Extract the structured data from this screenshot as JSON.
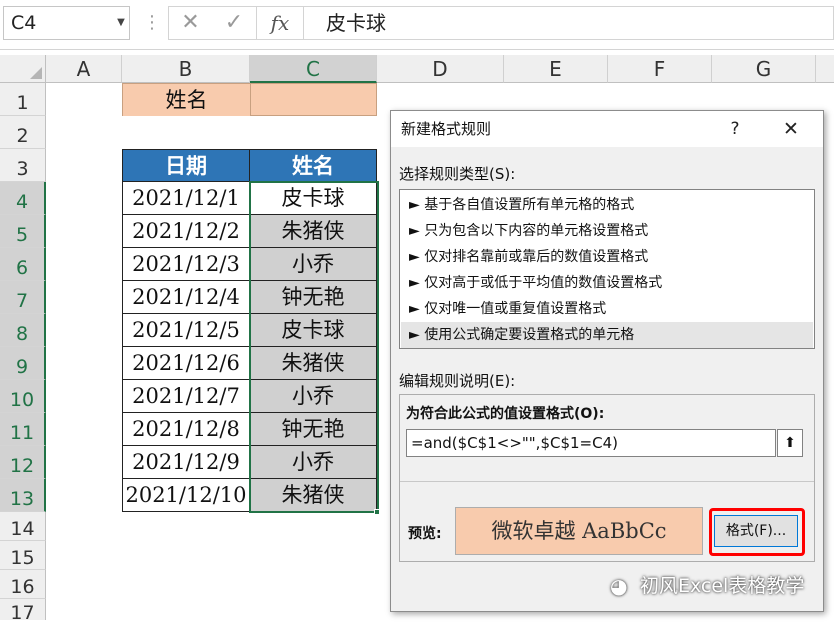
{
  "formula_bar": {
    "name_box": "C4",
    "cancel_icon": "✕",
    "enter_icon": "✓",
    "fx_label": "fx",
    "formula": "皮卡球"
  },
  "columns": [
    "A",
    "B",
    "C",
    "D",
    "E",
    "F",
    "G"
  ],
  "rows": [
    "1",
    "2",
    "3",
    "4",
    "5",
    "6",
    "7",
    "8",
    "9",
    "10",
    "11",
    "12",
    "13",
    "14",
    "15",
    "16",
    "17"
  ],
  "sheet": {
    "b1": "姓名",
    "c1": "",
    "table_headers": [
      "日期",
      "姓名"
    ],
    "table_rows": [
      [
        "2021/12/1",
        "皮卡球"
      ],
      [
        "2021/12/2",
        "朱猪侠"
      ],
      [
        "2021/12/3",
        "小乔"
      ],
      [
        "2021/12/4",
        "钟无艳"
      ],
      [
        "2021/12/5",
        "皮卡球"
      ],
      [
        "2021/12/6",
        "朱猪侠"
      ],
      [
        "2021/12/7",
        "小乔"
      ],
      [
        "2021/12/8",
        "钟无艳"
      ],
      [
        "2021/12/9",
        "小乔"
      ],
      [
        "2021/12/10",
        "朱猪侠"
      ]
    ],
    "highlight_color": "#f8cbad",
    "header_color": "#2e75b6",
    "conditional_fill_color": "#d0d0d0"
  },
  "dialog": {
    "title": "新建格式规则",
    "help": "?",
    "close": "✕",
    "select_rule_type_label": "选择规则类型(S):",
    "rule_types": [
      "► 基于各自值设置所有单元格的格式",
      "► 只为包含以下内容的单元格设置格式",
      "► 仅对排名靠前或靠后的数值设置格式",
      "► 仅对高于或低于平均值的数值设置格式",
      "► 仅对唯一值或重复值设置格式",
      "► 使用公式确定要设置格式的单元格"
    ],
    "selected_rule_index": 5,
    "edit_description_label": "编辑规则说明(E):",
    "formula_label": "为符合此公式的值设置格式(O):",
    "formula_value": "=and($C$1<>\"\",$C$1=C4)",
    "collapse_icon": "⬆",
    "preview_label": "预览:",
    "preview_text": "微软卓越    AaBbCc",
    "format_button": "格式(F)..."
  },
  "watermark": {
    "icon": "wechat-icon",
    "text": "初风Excel表格教学"
  }
}
